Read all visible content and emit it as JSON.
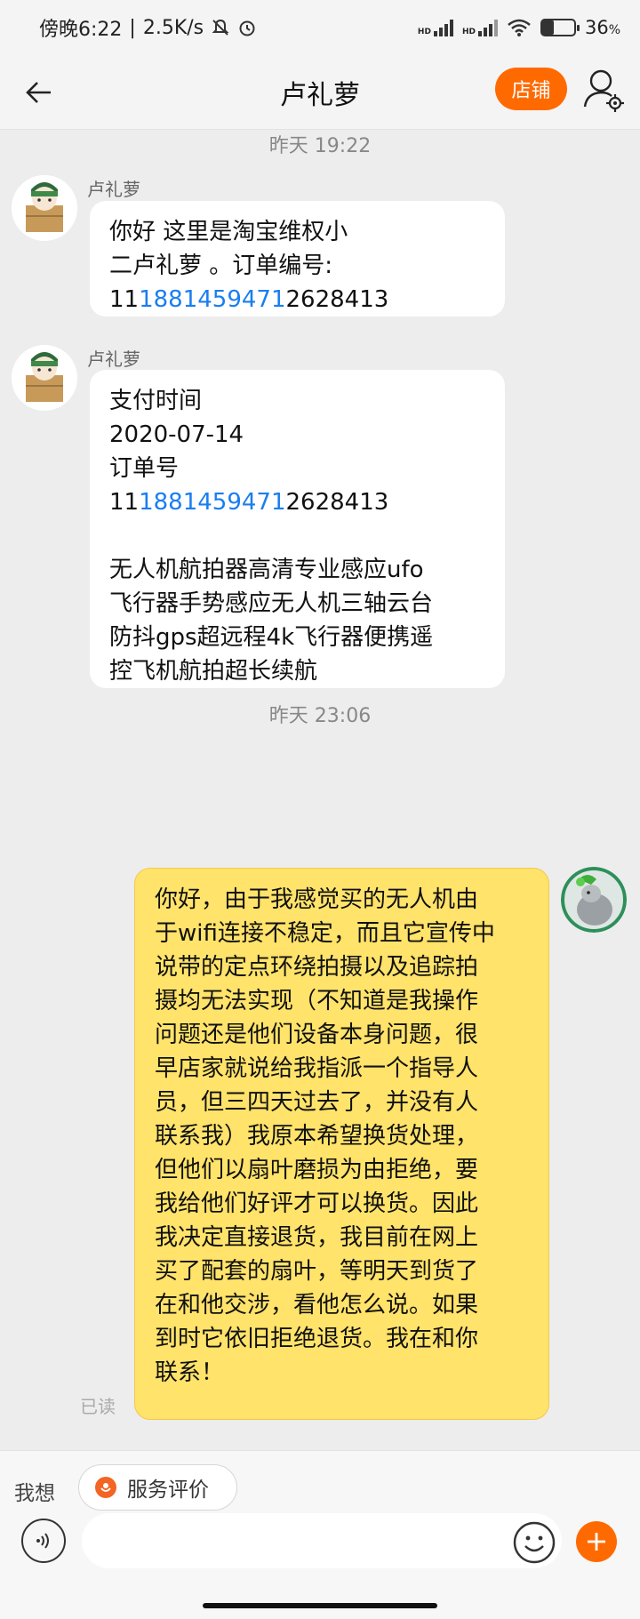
{
  "status_bar": {
    "time": "傍晚6:22",
    "speed": "2.5K/s",
    "battery": "36",
    "battery_unit": "%",
    "battery_level": 0.36,
    "net_tag_1": "HD",
    "net_tag_2": "HD"
  },
  "navbar": {
    "title": "卢礼萝",
    "shop_label": "店铺"
  },
  "chat": {
    "timestamps": [
      "昨天  19:22",
      "昨天  23:06"
    ],
    "messages": [
      {
        "sender": "卢礼萝",
        "lines": [
          "你好 这里是淘宝维权小",
          "二卢礼萝 。订单编号:"
        ],
        "order_prefix": "11",
        "order_link": "1881459471",
        "order_suffix": "2628413"
      },
      {
        "sender": "卢礼萝",
        "lines": [
          "支付时间",
          "2020-07-14",
          "订单号"
        ],
        "order_prefix": "11",
        "order_link": "1881459471",
        "order_suffix": "2628413",
        "product_lines": [
          "无人机航拍器高清专业感应ufo",
          "飞行器手势感应无人机三轴云台",
          "防抖gps超远程4k飞行器便携遥",
          "控飞机航拍超长续航"
        ]
      },
      {
        "sender": "me",
        "lines": [
          "你好，由于我感觉买的无人机由",
          "于wifi连接不稳定，而且它宣传中",
          "说带的定点环绕拍摄以及追踪拍",
          "摄均无法实现（不知道是我操作",
          "问题还是他们设备本身问题，很",
          "早店家就说给我指派一个指导人",
          "员，但三四天过去了，并没有人",
          "联系我）我原本希望换货处理，",
          "但他们以扇叶磨损为由拒绝，要",
          "我给他们好评才可以换货。因此",
          "我决定直接退货，我目前在网上",
          "买了配套的扇叶，等明天到货了",
          "在和他交涉，看他怎么说。如果",
          "到时它依旧拒绝退货。我在和你",
          "联系！"
        ],
        "status": "已读"
      }
    ]
  },
  "bottom": {
    "wish_label": "我想",
    "rate_label": "服务评价",
    "input_value": "",
    "input_placeholder": ""
  },
  "colors": {
    "accent": "#ff6a00",
    "link": "#1a7ef0",
    "my_bubble": "#ffe36a"
  },
  "icons": [
    "back-arrow-icon",
    "profile-settings-icon",
    "voice-icon",
    "emoji-icon",
    "plus-icon",
    "service-rating-icon"
  ]
}
